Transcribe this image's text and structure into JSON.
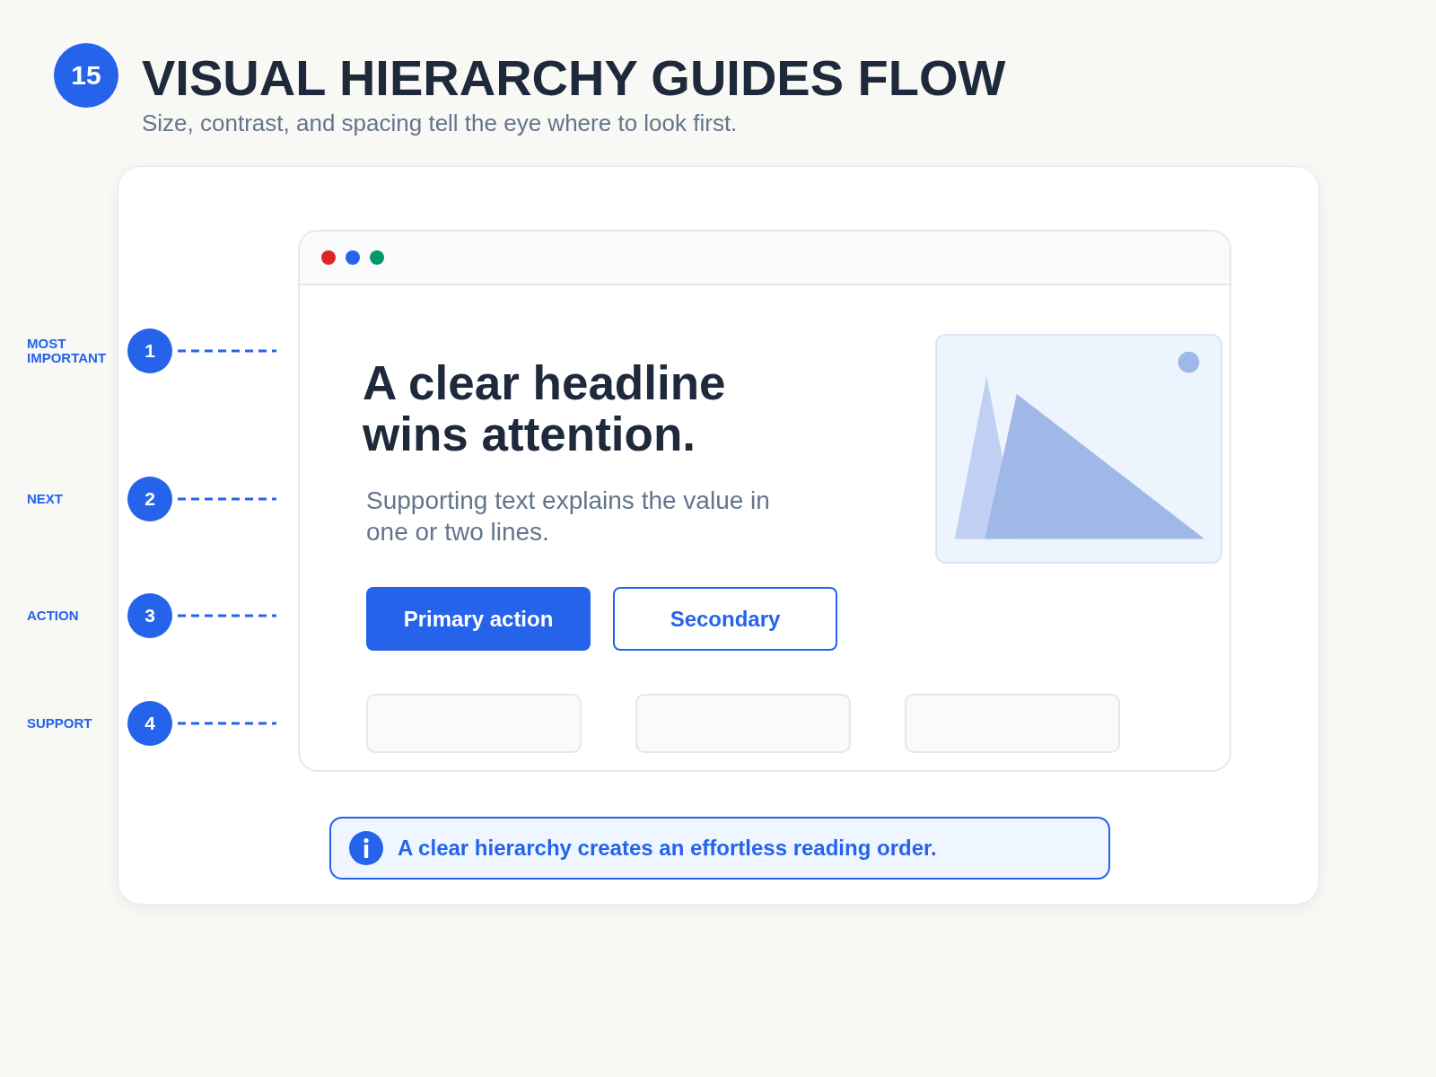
{
  "header": {
    "badge": "15",
    "title": "VISUAL HIERARCHY GUIDES FLOW",
    "subtitle": "Size, contrast, and spacing tell the eye where to look first."
  },
  "annotations": [
    {
      "label": "MOST IMPORTANT",
      "number": "1"
    },
    {
      "label": "NEXT",
      "number": "2"
    },
    {
      "label": "ACTION",
      "number": "3"
    },
    {
      "label": "SUPPORT",
      "number": "4"
    }
  ],
  "mockup": {
    "window_dots": [
      {
        "color": "#dc2626"
      },
      {
        "color": "#2563eb"
      },
      {
        "color": "#059669"
      }
    ],
    "headline": "A clear headline wins attention.",
    "body": "Supporting text explains the value in one or two lines.",
    "buttons": [
      {
        "label": "Primary action",
        "kind": "primary"
      },
      {
        "label": "Secondary",
        "kind": "secondary"
      }
    ],
    "support_cards": [
      {
        "kind": "placeholder"
      },
      {
        "kind": "placeholder"
      },
      {
        "kind": "placeholder"
      }
    ]
  },
  "note": {
    "text": "A clear hierarchy creates an effortless reading order."
  }
}
